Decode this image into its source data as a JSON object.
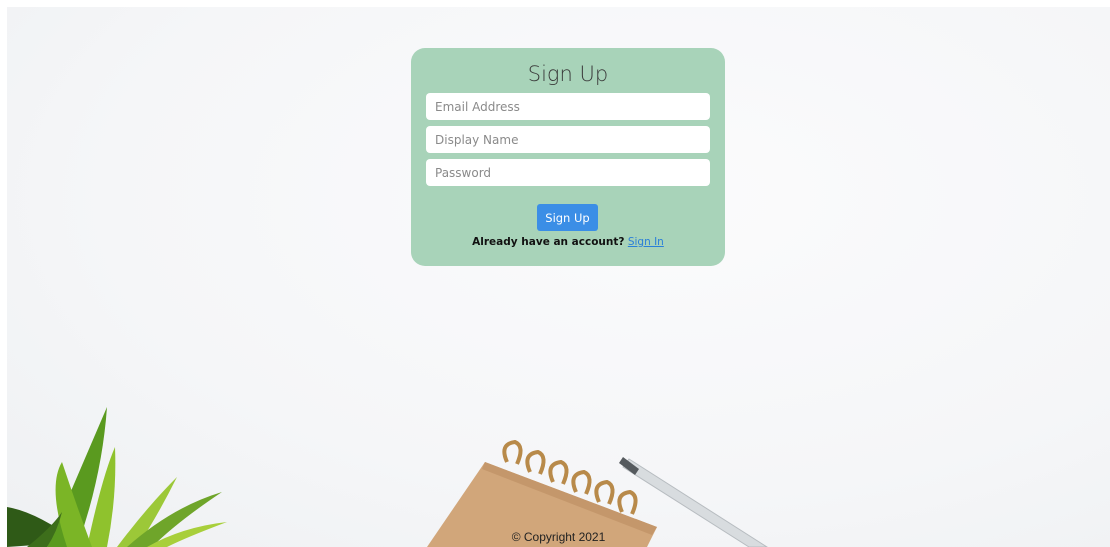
{
  "signup": {
    "title": "Sign Up",
    "email_placeholder": "Email Address",
    "display_name_placeholder": "Display Name",
    "password_placeholder": "Password",
    "submit_label": "Sign Up",
    "have_account_text": "Already have an account?",
    "signin_link": "Sign In"
  },
  "footer": {
    "copyright": "© Copyright 2021"
  },
  "colors": {
    "card_bg": "#a8d3b9",
    "button_bg": "#3b8ee6",
    "link": "#2a7fd8"
  },
  "icons": [
    "plant-image",
    "notebook-image",
    "pen-image"
  ]
}
